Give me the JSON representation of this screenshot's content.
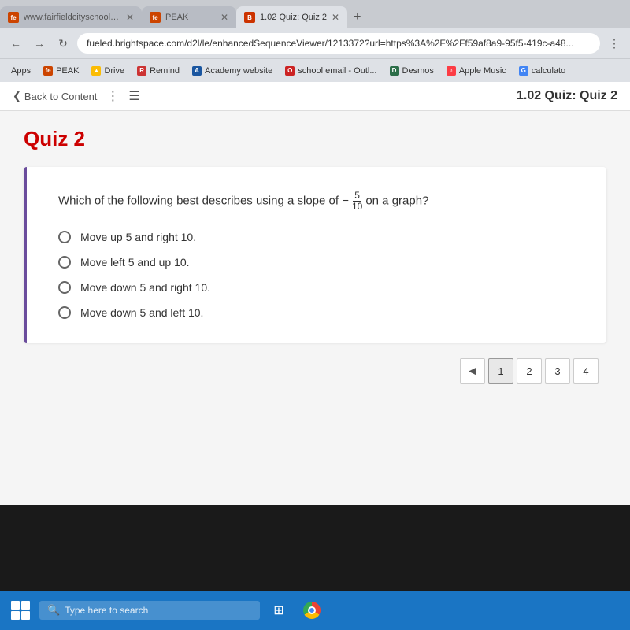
{
  "browser": {
    "tabs": [
      {
        "id": "tab1",
        "label": "www.fairfieldcityschools.net/links",
        "favicon_color": "#cc4400",
        "favicon_text": "fe",
        "active": false
      },
      {
        "id": "tab2",
        "label": "PEAK",
        "favicon_color": "#cc4400",
        "favicon_text": "fe",
        "active": false
      },
      {
        "id": "tab3",
        "label": "1.02 Quiz: Quiz 2",
        "favicon_color": "#cc3300",
        "favicon_text": "B",
        "active": true
      }
    ],
    "address_url": "fueled.brightspace.com/d2l/le/enhancedSequenceViewer/1213372?url=https%3A%2F%2Ff59af8a9-95f5-419c-a48...",
    "bookmarks": [
      {
        "label": "Apps",
        "favicon_color": null,
        "favicon_text": null
      },
      {
        "label": "PEAK",
        "favicon_color": "#cc4400",
        "favicon_text": "fe"
      },
      {
        "label": "Drive",
        "favicon_color": "#4285f4",
        "favicon_text": "▲"
      },
      {
        "label": "Remind",
        "favicon_color": "#cc3333",
        "favicon_text": "R"
      },
      {
        "label": "Academy website",
        "favicon_color": "#1a56a0",
        "favicon_text": "A"
      },
      {
        "label": "school email - Outl...",
        "favicon_color": "#cc2222",
        "favicon_text": "O"
      },
      {
        "label": "Desmos",
        "favicon_color": "#2c6e49",
        "favicon_text": "D"
      },
      {
        "label": "Apple Music",
        "favicon_color": "#fc3c44",
        "favicon_text": "♪"
      },
      {
        "label": "calculato",
        "favicon_color": "#4285f4",
        "favicon_text": "G"
      }
    ]
  },
  "content": {
    "back_label": "Back to Content",
    "page_title": "1.02 Quiz: Quiz 2",
    "quiz_title": "Quiz 2",
    "question_text_before": "Which of the following best describes using a slope of −",
    "fraction_numerator": "5",
    "fraction_denominator": "10",
    "question_text_after": "on a graph?",
    "options": [
      {
        "id": "opt1",
        "text": "Move up 5 and right 10."
      },
      {
        "id": "opt2",
        "text": "Move left 5 and up 10."
      },
      {
        "id": "opt3",
        "text": "Move down 5 and right 10."
      },
      {
        "id": "opt4",
        "text": "Move down 5 and left 10."
      }
    ],
    "pagination": {
      "prev_label": "◀",
      "pages": [
        "1",
        "2",
        "3",
        "4"
      ]
    }
  },
  "taskbar": {
    "search_placeholder": "Type here to search"
  }
}
